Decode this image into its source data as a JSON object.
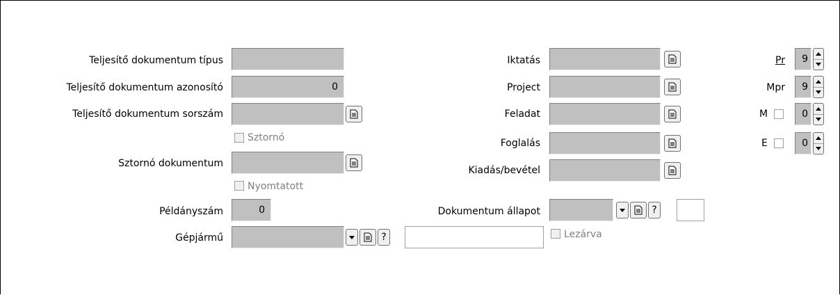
{
  "left": {
    "doc_type_label": "Teljesítő dokumentum típus",
    "doc_id_label": "Teljesítő dokumentum azonosító",
    "doc_id_value": "0",
    "doc_serial_label": "Teljesítő dokumentum sorszám",
    "storno_check_label": "Sztornó",
    "storno_doc_label": "Sztornó dokumentum",
    "printed_check_label": "Nyomtatott",
    "copies_label": "Példányszám",
    "copies_value": "0",
    "vehicle_label": "Gépjármű",
    "vehicle_help": "?"
  },
  "middle": {
    "registration_label": "Iktatás",
    "project_label": "Project",
    "task_label": "Feladat",
    "booking_label": "Foglalás",
    "expense_income_label": "Kiadás/bevétel",
    "doc_status_label": "Dokumentum állapot",
    "doc_status_help": "?",
    "closed_check_label": "Lezárva"
  },
  "right": {
    "pr_label": "Pr",
    "pr_value": "9",
    "mpr_label": "Mpr",
    "mpr_value": "9",
    "m_label": "M",
    "m_value": "0",
    "e_label": "E",
    "e_value": "0"
  }
}
